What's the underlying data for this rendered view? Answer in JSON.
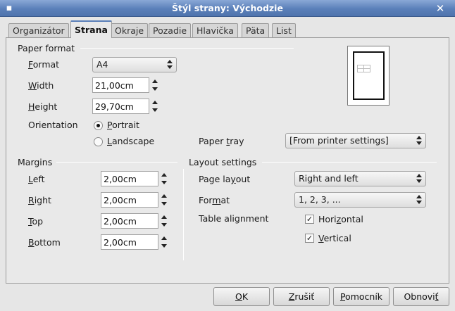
{
  "window": {
    "title": "Štýl strany: Východzie",
    "close_glyph": "✕"
  },
  "tabs": [
    {
      "label": "Organizátor",
      "active": false
    },
    {
      "label": "Strana",
      "active": true
    },
    {
      "label": "Okraje",
      "active": false
    },
    {
      "label": "Pozadie",
      "active": false
    },
    {
      "label": "Hlavička",
      "active": false
    },
    {
      "label": "Päta",
      "active": false
    },
    {
      "label": "List",
      "active": false
    }
  ],
  "paper_format": {
    "heading": "Paper format",
    "format_label": "Format",
    "format_value": "A4",
    "width_label": "Width",
    "width_value": "21,00cm",
    "height_label": "Height",
    "height_value": "29,70cm",
    "orientation_label": "Orientation",
    "portrait_label": "Portrait",
    "landscape_label": "Landscape",
    "orientation_selected": "Portrait",
    "paper_tray_label": "Paper tray",
    "paper_tray_value": "[From printer settings]"
  },
  "margins": {
    "heading": "Margins",
    "left_label": "Left",
    "left_value": "2,00cm",
    "right_label": "Right",
    "right_value": "2,00cm",
    "top_label": "Top",
    "top_value": "2,00cm",
    "bottom_label": "Bottom",
    "bottom_value": "2,00cm"
  },
  "layout": {
    "heading": "Layout settings",
    "page_layout_label": "Page layout",
    "page_layout_value": "Right and left",
    "format_label": "Format",
    "format_value": "1, 2, 3, ...",
    "table_alignment_label": "Table alignment",
    "horizontal_label": "Horizontal",
    "horizontal_checked": true,
    "vertical_label": "Vertical",
    "vertical_checked": true
  },
  "buttons": {
    "ok": "OK",
    "cancel": "Zrušiť",
    "help": "Pomocník",
    "reset": "Obnoviť"
  },
  "colors": {
    "titlebar": "#5a7fb9",
    "background": "#e6e6e6"
  }
}
